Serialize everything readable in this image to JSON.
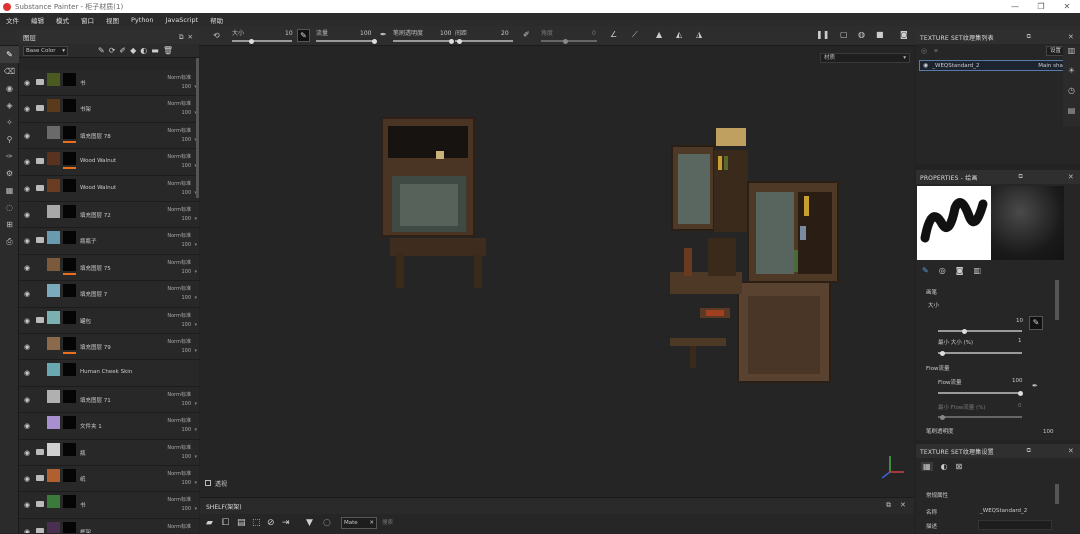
{
  "window": {
    "title": "Substance Painter - 柜子材质(1)",
    "controls": [
      "—",
      "❐",
      "✕"
    ]
  },
  "menu": [
    "文件",
    "编辑",
    "模式",
    "窗口",
    "视图",
    "Python",
    "JavaScript",
    "帮助"
  ],
  "toolbar": {
    "size_label": "大小",
    "size_value": "10",
    "flow_label": "流量",
    "flow_value": "100",
    "stroke_opacity_label": "笔刷透明度",
    "stroke_opacity_value": "100",
    "spacing_label": "间距",
    "spacing_value": "20",
    "angle_label": "角度",
    "angle_value": "0"
  },
  "layers_panel": {
    "title": "图层",
    "channel": "Base Color",
    "layers": [
      {
        "name": "书",
        "blend": "Norm标准",
        "opacity": "100",
        "type": "folder",
        "thumb": "#4a5a20",
        "orange": false
      },
      {
        "name": "书架",
        "blend": "Norm标准",
        "opacity": "100",
        "type": "folder",
        "thumb": "#5a3a1a",
        "orange": false
      },
      {
        "name": "填充图层 78",
        "blend": "Norm标准",
        "opacity": "100",
        "type": "fill",
        "thumb": "#6a6a6a",
        "orange": true
      },
      {
        "name": "Wood Walnut",
        "blend": "Norm标准",
        "opacity": "100",
        "type": "folder",
        "thumb": "#5a3320",
        "orange": true
      },
      {
        "name": "Wood Walnut",
        "blend": "Norm标准",
        "opacity": "100",
        "type": "folder",
        "thumb": "#6a3c22",
        "orange": false
      },
      {
        "name": "填充图层 72",
        "blend": "Norm标准",
        "opacity": "100",
        "type": "fill",
        "thumb": "#a8a8a8",
        "orange": false
      },
      {
        "name": "瓶瓶子",
        "blend": "Norm标准",
        "opacity": "100",
        "type": "folder",
        "thumb": "#6a9ab0",
        "orange": false
      },
      {
        "name": "填充图层 75",
        "blend": "Norm标准",
        "opacity": "100",
        "type": "fill",
        "thumb": "#7a5a3a",
        "orange": true
      },
      {
        "name": "填充图层 7",
        "blend": "Norm标准",
        "opacity": "100",
        "type": "fill",
        "thumb": "#7aaabb",
        "orange": false
      },
      {
        "name": "罐包",
        "blend": "Norm标准",
        "opacity": "100",
        "type": "folder",
        "thumb": "#7ab0b0",
        "orange": false
      },
      {
        "name": "填充图层 79",
        "blend": "Norm标准",
        "opacity": "100",
        "type": "fill",
        "thumb": "#8a6a4a",
        "orange": true
      },
      {
        "name": "Human Cheek Skin",
        "blend": "",
        "opacity": "",
        "type": "fill",
        "thumb": "#6aa8b0",
        "orange": false
      },
      {
        "name": "填充图层 71",
        "blend": "Norm标准",
        "opacity": "100",
        "type": "fill",
        "thumb": "#b0b0b0",
        "orange": false
      },
      {
        "name": "文件夹 1",
        "blend": "Norm标准",
        "opacity": "100",
        "type": "fill",
        "thumb": "#a890d0",
        "orange": false
      },
      {
        "name": "瓶",
        "blend": "Norm标准",
        "opacity": "100",
        "type": "folder",
        "thumb": "#d0d0d0",
        "orange": false
      },
      {
        "name": "纸",
        "blend": "Norm标准",
        "opacity": "100",
        "type": "folder",
        "thumb": "#b06030",
        "orange": false
      },
      {
        "name": "书",
        "blend": "Norm标准",
        "opacity": "100",
        "type": "folder",
        "thumb": "#3a7a3a",
        "orange": false
      },
      {
        "name": "框架",
        "blend": "Norm标准",
        "opacity": "100",
        "type": "folder",
        "thumb": "#4a3050",
        "orange": false
      }
    ]
  },
  "viewport": {
    "material_dropdown": "材质",
    "bottom_label": "透视"
  },
  "shelf": {
    "title": "SHELF(架架)",
    "filter_tag": "Mate",
    "search_placeholder": "搜索"
  },
  "texture_set_list": {
    "title": "TEXTURE SET纹理集列表",
    "settings_label": "设置",
    "item_name": "_WEQStandard_2",
    "item_shader": "Main shader"
  },
  "properties": {
    "title": "PROPERTIES - 绘画",
    "section": "画笔",
    "size_label": "大小",
    "size_value": "10",
    "min_size_label": "最小 大小 (%)",
    "min_size_value": "1",
    "flow_section": "Flow流量",
    "flow_label": "Flow流量",
    "flow_value": "100",
    "min_flow_label": "最小 Flow流量 (%)",
    "min_flow_value": "0",
    "stroke_opacity_label": "笔刷透明度",
    "stroke_opacity_value": "100"
  },
  "texture_set_settings": {
    "title": "TEXTURE SET纹理集设置",
    "section": "常规属性",
    "name_label": "名称",
    "name_value": "_WEQStandard_2",
    "desc_label": "描述"
  }
}
